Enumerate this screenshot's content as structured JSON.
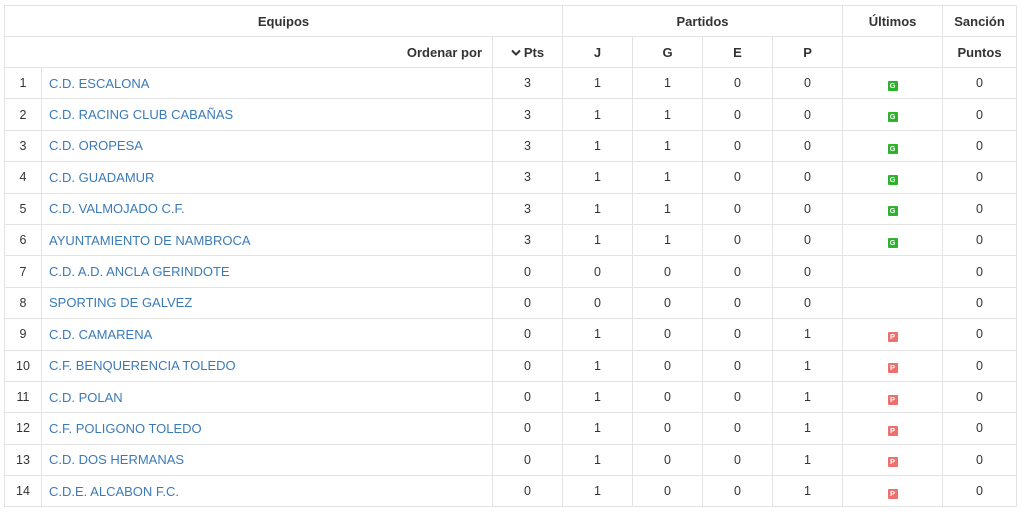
{
  "header": {
    "equipos": "Equipos",
    "partidos": "Partidos",
    "ultimos": "Últimos",
    "sancion": "Sanción",
    "ordenar_por": "Ordenar por",
    "pts": "Pts",
    "j": "J",
    "g": "G",
    "e": "E",
    "p": "P",
    "puntos": "Puntos"
  },
  "colors": {
    "link": "#3b7ab8",
    "win_badge": "#2bb32b",
    "loss_badge": "#ef6f6c"
  },
  "icons": {
    "sort": "chevron-down-icon"
  },
  "rows": [
    {
      "pos": "1",
      "team": "C.D. ESCALONA",
      "pts": "3",
      "j": "1",
      "g": "1",
      "e": "0",
      "p": "0",
      "last": "G",
      "sancion": "0"
    },
    {
      "pos": "2",
      "team": "C.D. RACING CLUB CABAÑAS",
      "pts": "3",
      "j": "1",
      "g": "1",
      "e": "0",
      "p": "0",
      "last": "G",
      "sancion": "0"
    },
    {
      "pos": "3",
      "team": "C.D. OROPESA",
      "pts": "3",
      "j": "1",
      "g": "1",
      "e": "0",
      "p": "0",
      "last": "G",
      "sancion": "0"
    },
    {
      "pos": "4",
      "team": "C.D. GUADAMUR",
      "pts": "3",
      "j": "1",
      "g": "1",
      "e": "0",
      "p": "0",
      "last": "G",
      "sancion": "0"
    },
    {
      "pos": "5",
      "team": "C.D. VALMOJADO C.F.",
      "pts": "3",
      "j": "1",
      "g": "1",
      "e": "0",
      "p": "0",
      "last": "G",
      "sancion": "0"
    },
    {
      "pos": "6",
      "team": "AYUNTAMIENTO DE NAMBROCA",
      "pts": "3",
      "j": "1",
      "g": "1",
      "e": "0",
      "p": "0",
      "last": "G",
      "sancion": "0"
    },
    {
      "pos": "7",
      "team": "C.D. A.D. ANCLA GERINDOTE",
      "pts": "0",
      "j": "0",
      "g": "0",
      "e": "0",
      "p": "0",
      "last": "",
      "sancion": "0"
    },
    {
      "pos": "8",
      "team": "SPORTING DE GALVEZ",
      "pts": "0",
      "j": "0",
      "g": "0",
      "e": "0",
      "p": "0",
      "last": "",
      "sancion": "0"
    },
    {
      "pos": "9",
      "team": "C.D. CAMARENA",
      "pts": "0",
      "j": "1",
      "g": "0",
      "e": "0",
      "p": "1",
      "last": "P",
      "sancion": "0"
    },
    {
      "pos": "10",
      "team": "C.F. BENQUERENCIA TOLEDO",
      "pts": "0",
      "j": "1",
      "g": "0",
      "e": "0",
      "p": "1",
      "last": "P",
      "sancion": "0"
    },
    {
      "pos": "11",
      "team": "C.D. POLAN",
      "pts": "0",
      "j": "1",
      "g": "0",
      "e": "0",
      "p": "1",
      "last": "P",
      "sancion": "0"
    },
    {
      "pos": "12",
      "team": "C.F. POLIGONO TOLEDO",
      "pts": "0",
      "j": "1",
      "g": "0",
      "e": "0",
      "p": "1",
      "last": "P",
      "sancion": "0"
    },
    {
      "pos": "13",
      "team": "C.D. DOS HERMANAS",
      "pts": "0",
      "j": "1",
      "g": "0",
      "e": "0",
      "p": "1",
      "last": "P",
      "sancion": "0"
    },
    {
      "pos": "14",
      "team": "C.D.E. ALCABON F.C.",
      "pts": "0",
      "j": "1",
      "g": "0",
      "e": "0",
      "p": "1",
      "last": "P",
      "sancion": "0"
    }
  ]
}
